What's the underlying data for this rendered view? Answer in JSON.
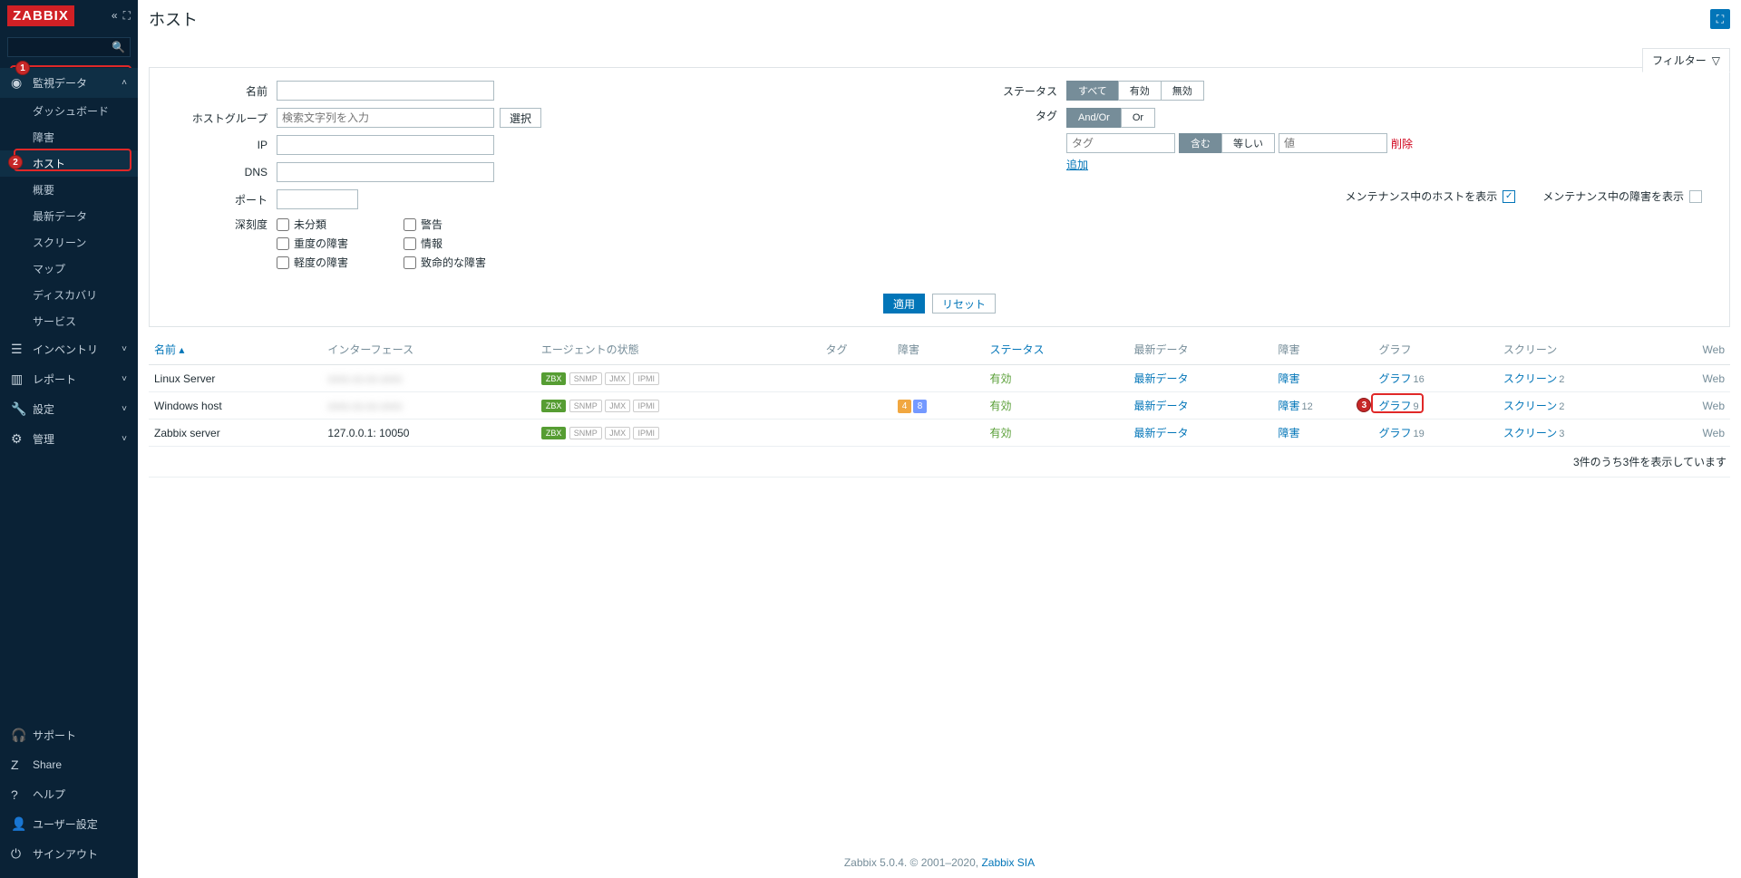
{
  "logo": "ZABBIX",
  "page_title": "ホスト",
  "filter_tab": "フィルター",
  "sidebar": {
    "monitoring": {
      "label": "監視データ"
    },
    "sub": {
      "dashboard": "ダッシュボード",
      "problems": "障害",
      "hosts": "ホスト",
      "overview": "概要",
      "latest": "最新データ",
      "screens": "スクリーン",
      "maps": "マップ",
      "discovery": "ディスカバリ",
      "services": "サービス"
    },
    "inventory": "インベントリ",
    "reports": "レポート",
    "config": "設定",
    "admin": "管理",
    "support": "サポート",
    "share": "Share",
    "help": "ヘルプ",
    "usersettings": "ユーザー設定",
    "signout": "サインアウト"
  },
  "filter": {
    "name_label": "名前",
    "hostgroups_label": "ホストグループ",
    "hostgroups_placeholder": "検索文字列を入力",
    "select_btn": "選択",
    "ip_label": "IP",
    "dns_label": "DNS",
    "port_label": "ポート",
    "severity_label": "深刻度",
    "sev": {
      "nc": "未分類",
      "info": "情報",
      "warn": "警告",
      "avg": "軽度の障害",
      "high": "重度の障害",
      "disaster": "致命的な障害"
    },
    "status_label": "ステータス",
    "status_all": "すべて",
    "status_enabled": "有効",
    "status_disabled": "無効",
    "tags_label": "タグ",
    "tag_andor": "And/Or",
    "tag_or": "Or",
    "tag_ph": "タグ",
    "contains": "含む",
    "equals": "等しい",
    "value_ph": "値",
    "delete": "削除",
    "add": "追加",
    "maint_hosts_label": "メンテナンス中のホストを表示",
    "maint_problems_label": "メンテナンス中の障害を表示",
    "apply": "適用",
    "reset": "リセット"
  },
  "table": {
    "headers": {
      "name": "名前",
      "interface": "インターフェース",
      "availability": "エージェントの状態",
      "tags": "タグ",
      "problems": "障害",
      "status": "ステータス",
      "latest": "最新データ",
      "problems2": "障害",
      "graphs": "グラフ",
      "screens": "スクリーン",
      "web": "Web"
    },
    "rows": [
      {
        "name": "Linux Server",
        "interface": "xxxx.xx.xx.xxxx",
        "status": "有効",
        "latest": "最新データ",
        "problems": "障害",
        "graphs": "グラフ",
        "graphs_n": "16",
        "screens": "スクリーン",
        "screens_n": "2",
        "web": "Web",
        "p4": "",
        "p8": ""
      },
      {
        "name": "Windows host",
        "interface": "xxxx.xx.xx.xxxx",
        "status": "有効",
        "latest": "最新データ",
        "problems": "障害",
        "problems_n": "12",
        "graphs": "グラフ",
        "graphs_n": "9",
        "screens": "スクリーン",
        "screens_n": "2",
        "web": "Web",
        "p4": "4",
        "p8": "8"
      },
      {
        "name": "Zabbix server",
        "interface": "127.0.0.1: 10050",
        "status": "有効",
        "latest": "最新データ",
        "problems": "障害",
        "graphs": "グラフ",
        "graphs_n": "19",
        "screens": "スクリーン",
        "screens_n": "3",
        "web": "Web",
        "p4": "",
        "p8": ""
      }
    ],
    "footer": "3件のうち3件を表示しています"
  },
  "footer": {
    "text": "Zabbix 5.0.4. © 2001–2020, ",
    "link": "Zabbix SIA"
  },
  "badges": {
    "zbx": "ZBX",
    "snmp": "SNMP",
    "jmx": "JMX",
    "ipmi": "IPMI"
  },
  "annotations": {
    "a1": "1",
    "a2": "2",
    "a3": "3"
  }
}
